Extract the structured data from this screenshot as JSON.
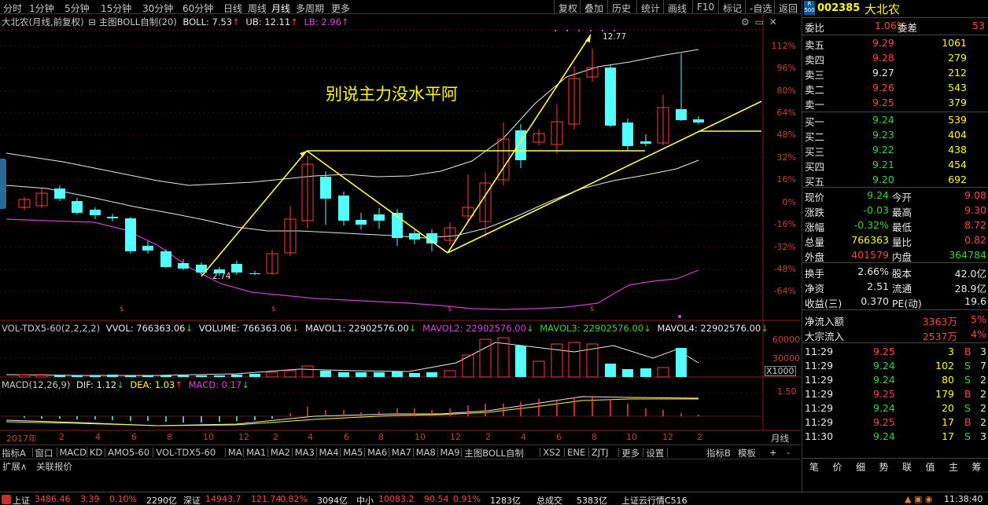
{
  "topbar": {
    "periods": [
      "分时",
      "1分钟",
      "5分钟",
      "15分钟",
      "30分钟",
      "60分钟",
      "日线",
      "周线",
      "月线",
      "多周期",
      "更多"
    ],
    "active": "月线",
    "right": [
      "复权",
      "叠加",
      "历史",
      "统计",
      "画线",
      "F10",
      "标记",
      "-自选",
      "返回"
    ]
  },
  "main_title": {
    "name": "大北农(月线,前复权)",
    "indicator": "主图BOLL自制(20)",
    "boll": "BOLL: 7.53",
    "ub": "UB: 12.11",
    "lb": "LB: 2.96"
  },
  "annotation": "别说主力没水平阿",
  "labels": {
    "high": "12.77",
    "low": "2.74"
  },
  "y_ticks": [
    "112%",
    "96%",
    "80%",
    "64%",
    "48%",
    "32%",
    "16%",
    "0%",
    "-16%",
    "-32%",
    "-48%",
    "-64%"
  ],
  "vol": {
    "name": "VOL-TDX5-60(2,2,2,2)",
    "vvol": "VVOL: 766363.06",
    "volume": "VOLUME: 766363.06",
    "mavol1": "MAVOL1: 22902576.00",
    "mavol2": "MAVOL2: 22902576.00",
    "mavol3": "MAVOL3: 22902576.00",
    "mavol4": "MAVOL4: 22902576.00",
    "ticks": [
      "60000",
      "30000"
    ],
    "unit": "X1000"
  },
  "macd": {
    "name": "MACD(12,26,9)",
    "dif": "DIF: 1.12",
    "dea": "DEA: 1.03",
    "macd": "MACD: 0.17",
    "tick": "1.50"
  },
  "x_axis": {
    "ticks": [
      "2017年",
      "2",
      "4",
      "6",
      "8",
      "10",
      "12",
      "2",
      "4",
      "6",
      "8",
      "10",
      "12",
      "2",
      "4",
      "6",
      "8",
      "10",
      "12",
      "2"
    ],
    "period": "月线"
  },
  "bottom_tabs": [
    "指标A",
    "窗口",
    "MACD",
    "KD",
    "AMO5-60",
    "VOL-TDX5-60",
    "MA",
    "MA1",
    "MA2",
    "MA3",
    "MA4",
    "MA5",
    "MA6",
    "MA7",
    "MA8",
    "MA9",
    "主图BOLL自制",
    "XS2",
    "ENE",
    "ZJTJ",
    "更多",
    "设置"
  ],
  "bottom_right": [
    "指标B",
    "模板",
    "+",
    "-"
  ],
  "expand": [
    "扩展∧",
    "关联报价"
  ],
  "stock": {
    "code": "002385",
    "name": "大北农",
    "badge_top": "R",
    "badge_bot": "500"
  },
  "weibi": {
    "l1": "委比",
    "v1": "1.06%",
    "l2": "委差",
    "v2": "53"
  },
  "asks": [
    {
      "label": "卖五",
      "price": "9.29",
      "vol": "1061"
    },
    {
      "label": "卖四",
      "price": "9.28",
      "vol": "279"
    },
    {
      "label": "卖三",
      "price": "9.27",
      "vol": "212"
    },
    {
      "label": "卖二",
      "price": "9.26",
      "vol": "543"
    },
    {
      "label": "卖一",
      "price": "9.25",
      "vol": "379"
    }
  ],
  "bids": [
    {
      "label": "买一",
      "price": "9.24",
      "vol": "539"
    },
    {
      "label": "买二",
      "price": "9.23",
      "vol": "404"
    },
    {
      "label": "买三",
      "price": "9.22",
      "vol": "438"
    },
    {
      "label": "买四",
      "price": "9.21",
      "vol": "454"
    },
    {
      "label": "买五",
      "price": "9.20",
      "vol": "692"
    }
  ],
  "quote": [
    {
      "l1": "现价",
      "v1": "9.24",
      "l2": "今开",
      "v2": "9.08"
    },
    {
      "l1": "涨跌",
      "v1": "-0.03",
      "l2": "最高",
      "v2": "9.30"
    },
    {
      "l1": "涨幅",
      "v1": "-0.32%",
      "l2": "最低",
      "v2": "8.72"
    },
    {
      "l1": "总量",
      "v1": "766363",
      "l2": "量比",
      "v2": "0.82"
    },
    {
      "l1": "外盘",
      "v1": "401579",
      "l2": "内盘",
      "v2": "364784"
    }
  ],
  "stats": [
    {
      "l1": "换手",
      "v1": "2.66%",
      "l2": "股本",
      "v2": "42.0亿"
    },
    {
      "l1": "净资",
      "v1": "2.51",
      "l2": "流通",
      "v2": "28.9亿"
    },
    {
      "l1": "收益(三)",
      "v1": "0.370",
      "l2": "PE(动)",
      "v2": "19.6"
    }
  ],
  "flows": [
    {
      "label": "净流入额",
      "v": "3363万",
      "p": "5%"
    },
    {
      "label": "大宗流入",
      "v": "2537万",
      "p": "4%"
    }
  ],
  "ticks": [
    {
      "t": "11:29",
      "p": "9.25",
      "v": "3",
      "d": "B",
      "n": "3"
    },
    {
      "t": "11:29",
      "p": "9.24",
      "v": "102",
      "d": "S",
      "n": "7"
    },
    {
      "t": "11:29",
      "p": "9.24",
      "v": "80",
      "d": "S",
      "n": "2"
    },
    {
      "t": "11:29",
      "p": "9.25",
      "v": "179",
      "d": "B",
      "n": "2"
    },
    {
      "t": "11:29",
      "p": "9.24",
      "v": "20",
      "d": "S",
      "n": "2"
    },
    {
      "t": "11:29",
      "p": "9.25",
      "v": "17",
      "d": "B",
      "n": "2"
    },
    {
      "t": "11:30",
      "p": "9.24",
      "v": "17",
      "d": "S",
      "n": "3"
    }
  ],
  "right_tabs": [
    "笔",
    "价",
    "细",
    "势",
    "联",
    "值",
    "主",
    "筹"
  ],
  "status": [
    {
      "name": "上证",
      "v1": "3486.46",
      "v2": "3.39",
      "v3": "0.10%",
      "amt": "2290亿"
    },
    {
      "name": "深证",
      "v1": "14943.7",
      "v2": "121.74",
      "v3": "0.82%",
      "amt": "3094亿"
    },
    {
      "name": "中小",
      "v1": "10083.2",
      "v2": "90.54",
      "v3": "0.91%",
      "amt": "1283亿"
    }
  ],
  "status_extra": {
    "total": "总成交",
    "total_v": "5383亿",
    "feed": "上证云行情C516",
    "time": "11:38:40"
  },
  "colors": {
    "up": "#ff3c3c",
    "down": "#54ffff",
    "boll_ub": "#e8e8e8",
    "boll_mid": "#e8e8e8",
    "boll_lb": "#d040d0",
    "annot": "#ffff00",
    "line": "#ffff40"
  }
}
